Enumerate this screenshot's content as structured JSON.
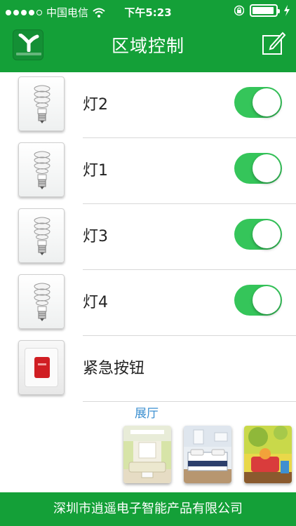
{
  "status_bar": {
    "carrier": "中国电信",
    "time": "下午5:23",
    "battery_level": 0.95
  },
  "header": {
    "title": "区域控制",
    "logo_icon": "company-logo-icon",
    "edit_icon": "edit-icon"
  },
  "devices": [
    {
      "label": "灯2",
      "icon": "bulb-icon",
      "on": true
    },
    {
      "label": "灯1",
      "icon": "bulb-icon",
      "on": true
    },
    {
      "label": "灯3",
      "icon": "bulb-icon",
      "on": true
    },
    {
      "label": "灯4",
      "icon": "bulb-icon",
      "on": true
    },
    {
      "label": "紧急按钮",
      "icon": "emergency-button-icon"
    }
  ],
  "room_section": {
    "title": "展厅",
    "rooms": [
      "living-room",
      "bedroom",
      "kids-room"
    ]
  },
  "footer": {
    "company": "深圳市逍遥电子智能产品有限公司"
  },
  "colors": {
    "brand_green": "#14a038",
    "toggle_on": "#35c55a",
    "section_blue": "#3b8fd0"
  }
}
